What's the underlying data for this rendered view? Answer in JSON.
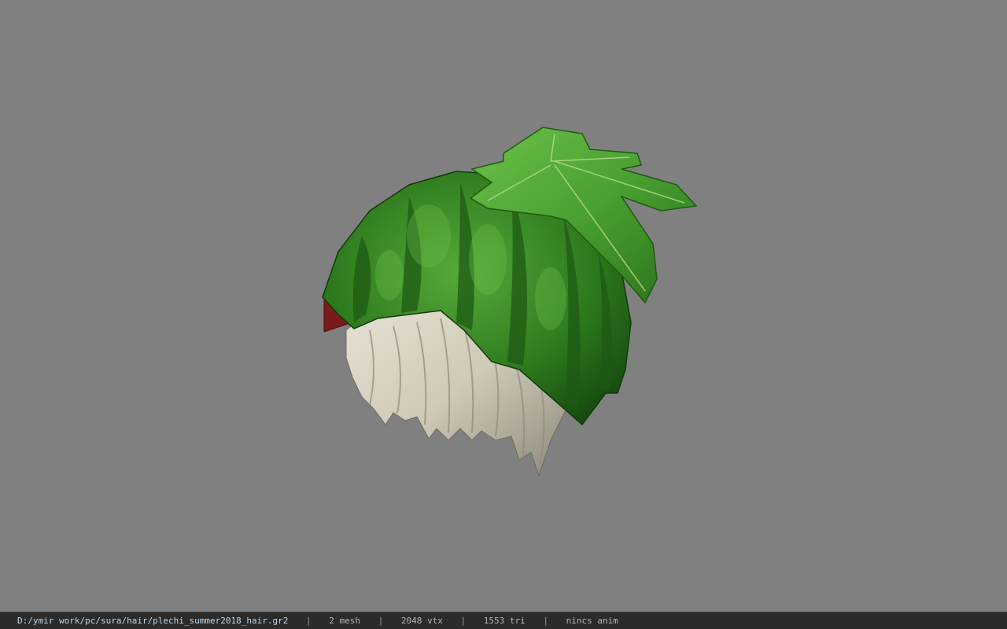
{
  "viewer": {
    "background_color": "#808080",
    "model": "watermelon-hair-mesh"
  },
  "statusbar": {
    "path": "D:/ymir work/pc/sura/hair/plechi_summer2018_hair.gr2",
    "separator": "|",
    "mesh": "2 mesh",
    "vertices": "2048 vtx",
    "triangles": "1553 tri",
    "anim": "nincs anim"
  }
}
